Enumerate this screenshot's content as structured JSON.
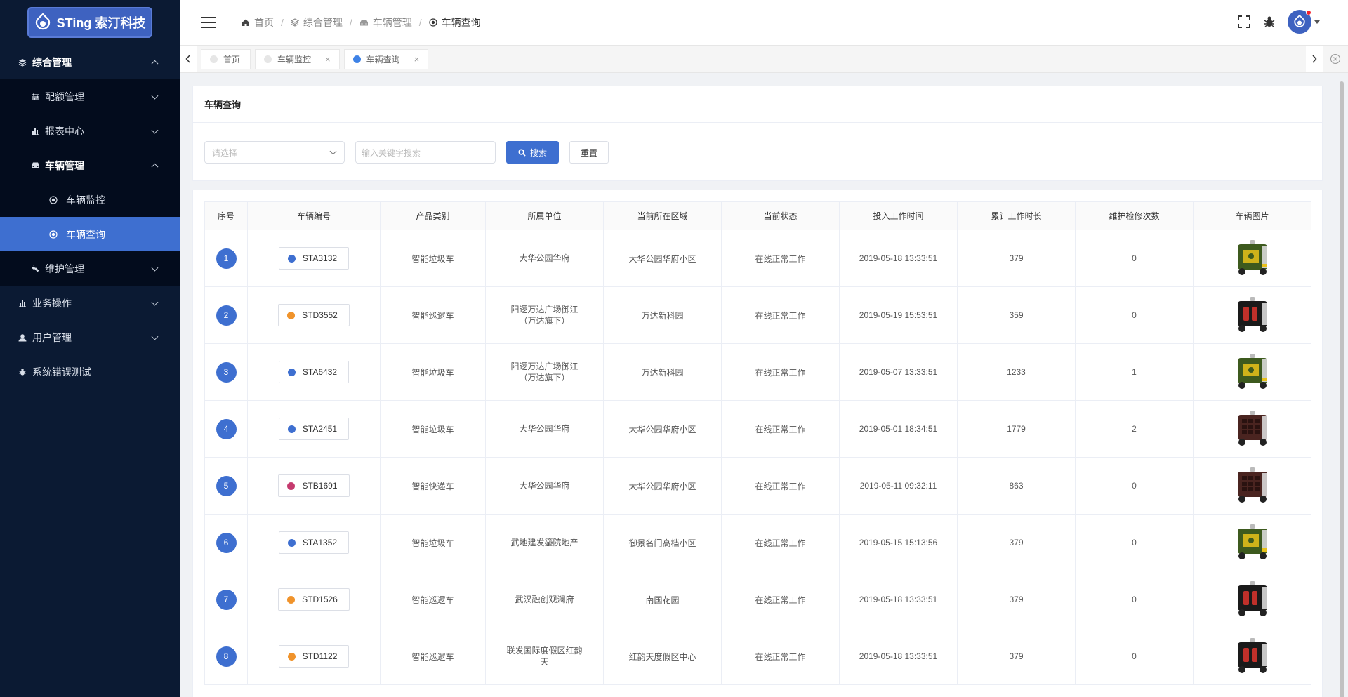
{
  "app": {
    "logo_text": "STing 索汀科技"
  },
  "sidebar": {
    "items": [
      {
        "label": "综合管理",
        "level": 1,
        "icon": "layers-icon",
        "expanded": true
      },
      {
        "label": "配额管理",
        "level": 2,
        "icon": "sliders-icon",
        "expanded": false
      },
      {
        "label": "报表中心",
        "level": 2,
        "icon": "bar-chart-icon",
        "expanded": false
      },
      {
        "label": "车辆管理",
        "level": 2,
        "icon": "car-icon",
        "expanded": true
      },
      {
        "label": "车辆监控",
        "level": 3,
        "icon": "radio-dot-icon"
      },
      {
        "label": "车辆查询",
        "level": 3,
        "icon": "radio-dot-icon",
        "active": true
      },
      {
        "label": "维护管理",
        "level": 2,
        "icon": "tools-icon",
        "expanded": false
      },
      {
        "label": "业务操作",
        "level": 1,
        "icon": "bar-chart-icon",
        "expanded": false
      },
      {
        "label": "用户管理",
        "level": 1,
        "icon": "user-icon",
        "expanded": false
      },
      {
        "label": "系统错误测试",
        "level": 1,
        "icon": "bug-icon"
      }
    ]
  },
  "header": {
    "breadcrumb": [
      {
        "label": "首页",
        "icon": "home-icon"
      },
      {
        "label": "综合管理",
        "icon": "layers-icon"
      },
      {
        "label": "车辆管理",
        "icon": "car-icon"
      },
      {
        "label": "车辆查询",
        "icon": "radio-dot-icon"
      }
    ]
  },
  "tabs": [
    {
      "label": "首页",
      "closable": false,
      "active": false
    },
    {
      "label": "车辆监控",
      "closable": true,
      "active": false
    },
    {
      "label": "车辆查询",
      "closable": true,
      "active": true
    }
  ],
  "search": {
    "title": "车辆查询",
    "select_placeholder": "请选择",
    "keyword_placeholder": "输入关键字搜索",
    "search_label": "搜索",
    "reset_label": "重置"
  },
  "table": {
    "columns": [
      "序号",
      "车辆编号",
      "产品类别",
      "所属单位",
      "当前所在区域",
      "当前状态",
      "投入工作时间",
      "累计工作时长",
      "维护检修次数",
      "车辆图片"
    ],
    "rows": [
      {
        "index": "1",
        "code": "STA3132",
        "dot_color": "#3e6fd0",
        "category": "智能垃圾车",
        "unit": "大华公园华府",
        "area": "大华公园华府小区",
        "status": "在线正常工作",
        "start_time": "2019-05-18 13:33:51",
        "hours": "379",
        "repairs": "0",
        "robot": "green"
      },
      {
        "index": "2",
        "code": "STD3552",
        "dot_color": "#f0932b",
        "category": "智能巡逻车",
        "unit": "阳逻万达广场御江（万达旗下）",
        "area": "万达新科园",
        "status": "在线正常工作",
        "start_time": "2019-05-19 15:53:51",
        "hours": "359",
        "repairs": "0",
        "robot": "black"
      },
      {
        "index": "3",
        "code": "STA6432",
        "dot_color": "#3e6fd0",
        "category": "智能垃圾车",
        "unit": "阳逻万达广场御江（万达旗下）",
        "area": "万达新科园",
        "status": "在线正常工作",
        "start_time": "2019-05-07 13:33:51",
        "hours": "1233",
        "repairs": "1",
        "robot": "green"
      },
      {
        "index": "4",
        "code": "STA2451",
        "dot_color": "#3e6fd0",
        "category": "智能垃圾车",
        "unit": "大华公园华府",
        "area": "大华公园华府小区",
        "status": "在线正常工作",
        "start_time": "2019-05-01 18:34:51",
        "hours": "1779",
        "repairs": "2",
        "robot": "brown"
      },
      {
        "index": "5",
        "code": "STB1691",
        "dot_color": "#c53a6e",
        "category": "智能快递车",
        "unit": "大华公园华府",
        "area": "大华公园华府小区",
        "status": "在线正常工作",
        "start_time": "2019-05-11 09:32:11",
        "hours": "863",
        "repairs": "0",
        "robot": "brown"
      },
      {
        "index": "6",
        "code": "STA1352",
        "dot_color": "#3e6fd0",
        "category": "智能垃圾车",
        "unit": "武地建发鎏院地产",
        "area": "御景名门高档小区",
        "status": "在线正常工作",
        "start_time": "2019-05-15 15:13:56",
        "hours": "379",
        "repairs": "0",
        "robot": "green"
      },
      {
        "index": "7",
        "code": "STD1526",
        "dot_color": "#f0932b",
        "category": "智能巡逻车",
        "unit": "武汉融创观澜府",
        "area": "南国花园",
        "status": "在线正常工作",
        "start_time": "2019-05-18 13:33:51",
        "hours": "379",
        "repairs": "0",
        "robot": "black"
      },
      {
        "index": "8",
        "code": "STD1122",
        "dot_color": "#f0932b",
        "category": "智能巡逻车",
        "unit": "联发国际度假区红韵天",
        "area": "红韵天度假区中心",
        "status": "在线正常工作",
        "start_time": "2019-05-18 13:33:51",
        "hours": "379",
        "repairs": "0",
        "robot": "black"
      }
    ]
  }
}
